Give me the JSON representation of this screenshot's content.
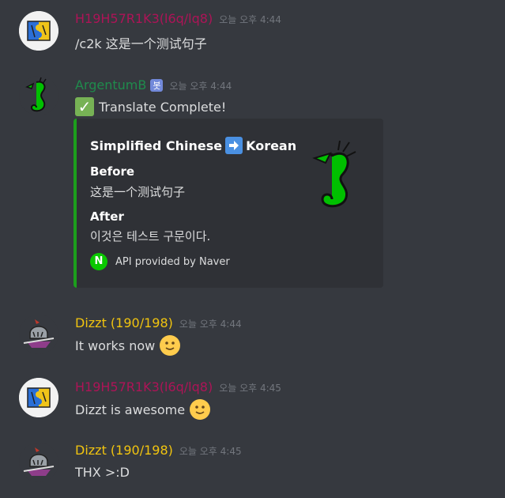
{
  "messages": [
    {
      "username": "H19H57R1K3(l6q/lq8)",
      "username_color": "#ad1457",
      "timestamp": "오늘 오후 4:44",
      "text": "/c2k 这是一个测试句子"
    },
    {
      "username": "ArgentumB",
      "username_color": "#1f8b4c",
      "bot_tag": "봇",
      "timestamp": "오늘 오후 4:44",
      "text": "Translate Complete!",
      "emoji": "check-mark",
      "embed": {
        "title_from": "Simplified Chinese",
        "title_to": "Korean",
        "field_before_name": "Before",
        "field_before_value": "这是一个测试句子",
        "field_after_name": "After",
        "field_after_value": "이것은 테스트 구문이다.",
        "footer_text": "API provided by Naver",
        "footer_icon_letter": "N",
        "border_color": "#1c9e1c"
      }
    },
    {
      "username": "Dizzt (190/198)",
      "username_color": "#f1c40f",
      "timestamp": "오늘 오후 4:44",
      "text": "It works now",
      "emoji": "slightly-smiling-face"
    },
    {
      "username": "H19H57R1K3(l6q/lq8)",
      "username_color": "#ad1457",
      "timestamp": "오늘 오후 4:45",
      "text": "Dizzt is awesome",
      "emoji": "slightly-smiling-face"
    },
    {
      "username": "Dizzt (190/198)",
      "username_color": "#f1c40f",
      "timestamp": "오늘 오후 4:45",
      "text": "THX >:D"
    }
  ]
}
